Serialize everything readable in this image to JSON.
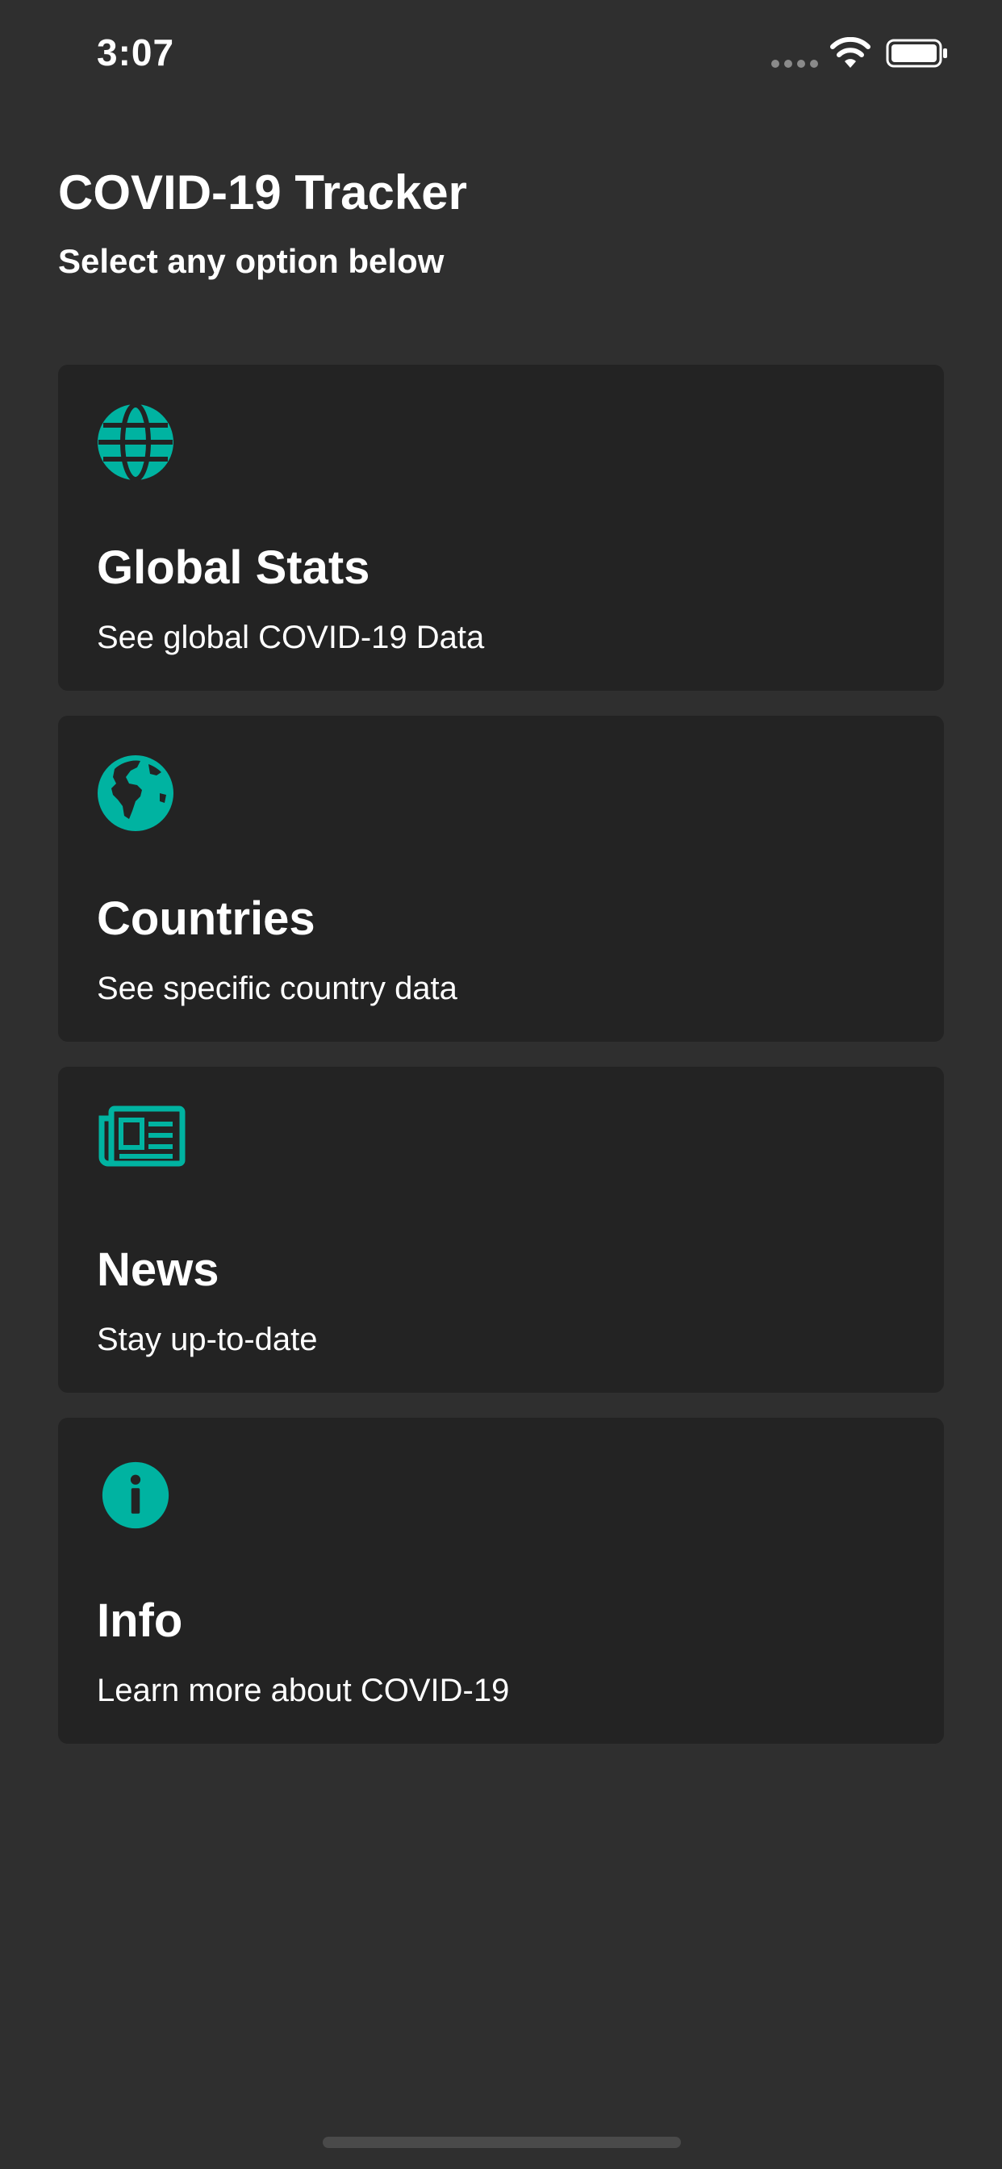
{
  "status_bar": {
    "time": "3:07"
  },
  "header": {
    "title": "COVID-19 Tracker",
    "subtitle": "Select any option below"
  },
  "cards": [
    {
      "title": "Global Stats",
      "description": "See global COVID-19 Data",
      "icon": "globe-grid-icon"
    },
    {
      "title": "Countries",
      "description": "See specific country data",
      "icon": "earth-americas-icon"
    },
    {
      "title": "News",
      "description": "Stay up-to-date",
      "icon": "newspaper-icon"
    },
    {
      "title": "Info",
      "description": "Learn more about COVID-19",
      "icon": "info-circle-icon"
    }
  ],
  "colors": {
    "accent": "#00b3a1",
    "background": "#2f2f2f",
    "card": "#232323"
  }
}
